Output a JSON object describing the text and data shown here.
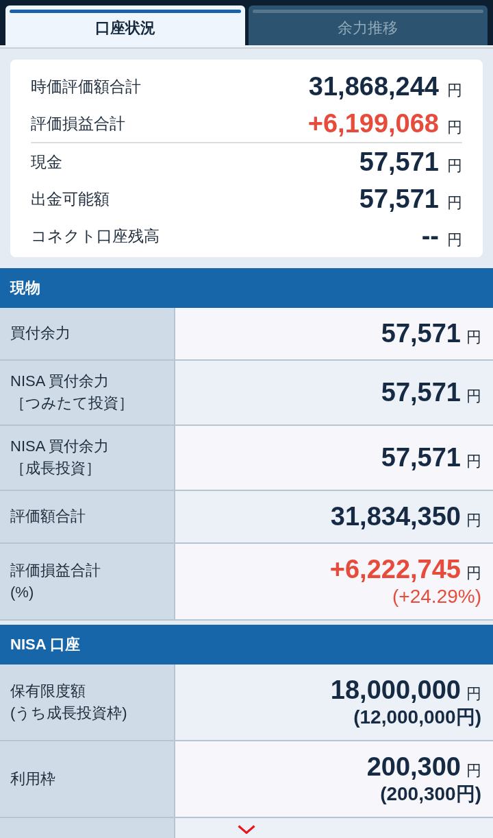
{
  "tabs": [
    {
      "label": "口座状況",
      "selected": true
    },
    {
      "label": "余力推移",
      "selected": false
    }
  ],
  "summary": {
    "totals": [
      {
        "label": "時価評価額合計",
        "value": "31,868,244",
        "unit": "円",
        "positive": false
      },
      {
        "label": "評価損益合計",
        "value": "+6,199,068",
        "unit": "円",
        "positive": true
      }
    ],
    "balances": [
      {
        "label": "現金",
        "value": "57,571",
        "unit": "円",
        "positive": false
      },
      {
        "label": "出金可能額",
        "value": "57,571",
        "unit": "円",
        "positive": false
      },
      {
        "label": "コネクト口座残高",
        "value": "--",
        "unit": "円",
        "positive": false
      }
    ]
  },
  "sections": [
    {
      "title": "現物",
      "rows": [
        {
          "label": [
            "買付余力"
          ],
          "value": "57,571",
          "unit": "円",
          "positive": false
        },
        {
          "label": [
            "NISA 買付余力",
            "［つみたて投資］"
          ],
          "value": "57,571",
          "unit": "円",
          "positive": false
        },
        {
          "label": [
            "NISA 買付余力",
            "［成長投資］"
          ],
          "value": "57,571",
          "unit": "円",
          "positive": false
        },
        {
          "label": [
            "評価額合計"
          ],
          "value": "31,834,350",
          "unit": "円",
          "positive": false
        },
        {
          "label": [
            "評価損益合計",
            "(%)"
          ],
          "value": "+6,222,745",
          "unit": "円",
          "positive": true,
          "sub_value": "(+24.29%)",
          "sub_positive": true
        }
      ]
    },
    {
      "title": "NISA 口座",
      "rows": [
        {
          "label": [
            "保有限度額",
            "(うち成長投資枠)"
          ],
          "value": "18,000,000",
          "unit": "円",
          "positive": false,
          "sub_value": "(12,000,000円)",
          "sub_positive": false
        },
        {
          "label": [
            "利用枠"
          ],
          "value": "200,300",
          "unit": "円",
          "positive": false,
          "sub_value": "(200,300円)",
          "sub_positive": false
        }
      ]
    }
  ],
  "more_below": true
}
